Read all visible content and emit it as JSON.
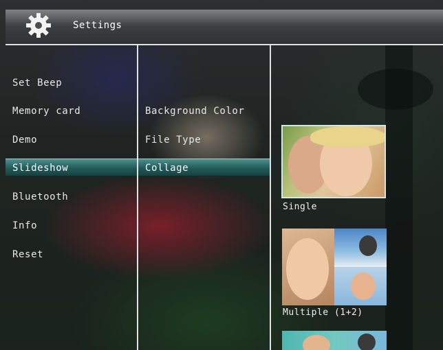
{
  "header": {
    "title": "Settings",
    "icon": "gear-icon"
  },
  "menu": {
    "items": [
      {
        "label": "Set Beep",
        "selected": false
      },
      {
        "label": "Memory card",
        "selected": false
      },
      {
        "label": "Demo",
        "selected": false
      },
      {
        "label": "Slideshow",
        "selected": true
      },
      {
        "label": "Bluetooth",
        "selected": false
      },
      {
        "label": "Info",
        "selected": false
      },
      {
        "label": "Reset",
        "selected": false
      }
    ]
  },
  "submenu": {
    "items": [
      {
        "label": "Background Color",
        "selected": false
      },
      {
        "label": "File Type",
        "selected": false
      },
      {
        "label": "Collage",
        "selected": true
      }
    ]
  },
  "options": {
    "items": [
      {
        "label": "Single",
        "selected": true
      },
      {
        "label": "Multiple (1+2)",
        "selected": false
      }
    ]
  },
  "colors": {
    "selection": "#2a6b69",
    "divider": "#dfe4e2"
  }
}
